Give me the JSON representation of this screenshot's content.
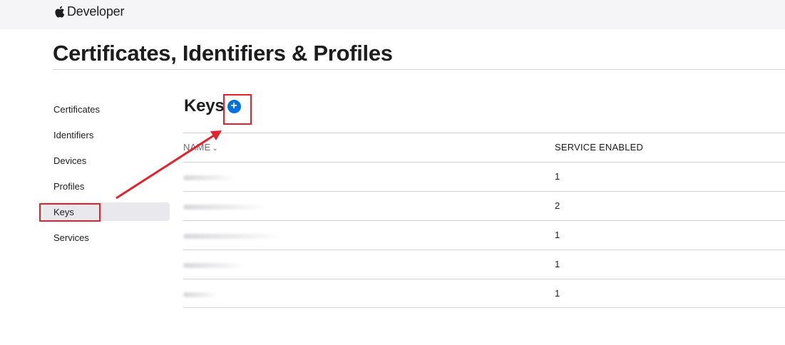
{
  "header": {
    "brand_label": "Developer",
    "logo_icon": "apple-logo-icon"
  },
  "page_title": "Certificates, Identifiers & Profiles",
  "sidebar": {
    "items": [
      {
        "label": "Certificates",
        "selected": false
      },
      {
        "label": "Identifiers",
        "selected": false
      },
      {
        "label": "Devices",
        "selected": false
      },
      {
        "label": "Profiles",
        "selected": false
      },
      {
        "label": "Keys",
        "selected": true
      },
      {
        "label": "Services",
        "selected": false
      }
    ]
  },
  "main": {
    "section_title": "Keys",
    "add_icon": "plus-circle-icon",
    "table": {
      "columns": [
        "NAME",
        "SERVICE ENABLED"
      ],
      "sort_indicator": "⌄",
      "rows": [
        {
          "name": "",
          "service_enabled": "1"
        },
        {
          "name": "",
          "service_enabled": "2"
        },
        {
          "name": "",
          "service_enabled": "1"
        },
        {
          "name": "",
          "service_enabled": "1"
        },
        {
          "name": "",
          "service_enabled": "1"
        }
      ]
    }
  },
  "colors": {
    "accent": "#0071e3",
    "annotation": "#e0232c",
    "topbar": "#f5f5f7",
    "selected_bg": "#e8e8ed"
  }
}
